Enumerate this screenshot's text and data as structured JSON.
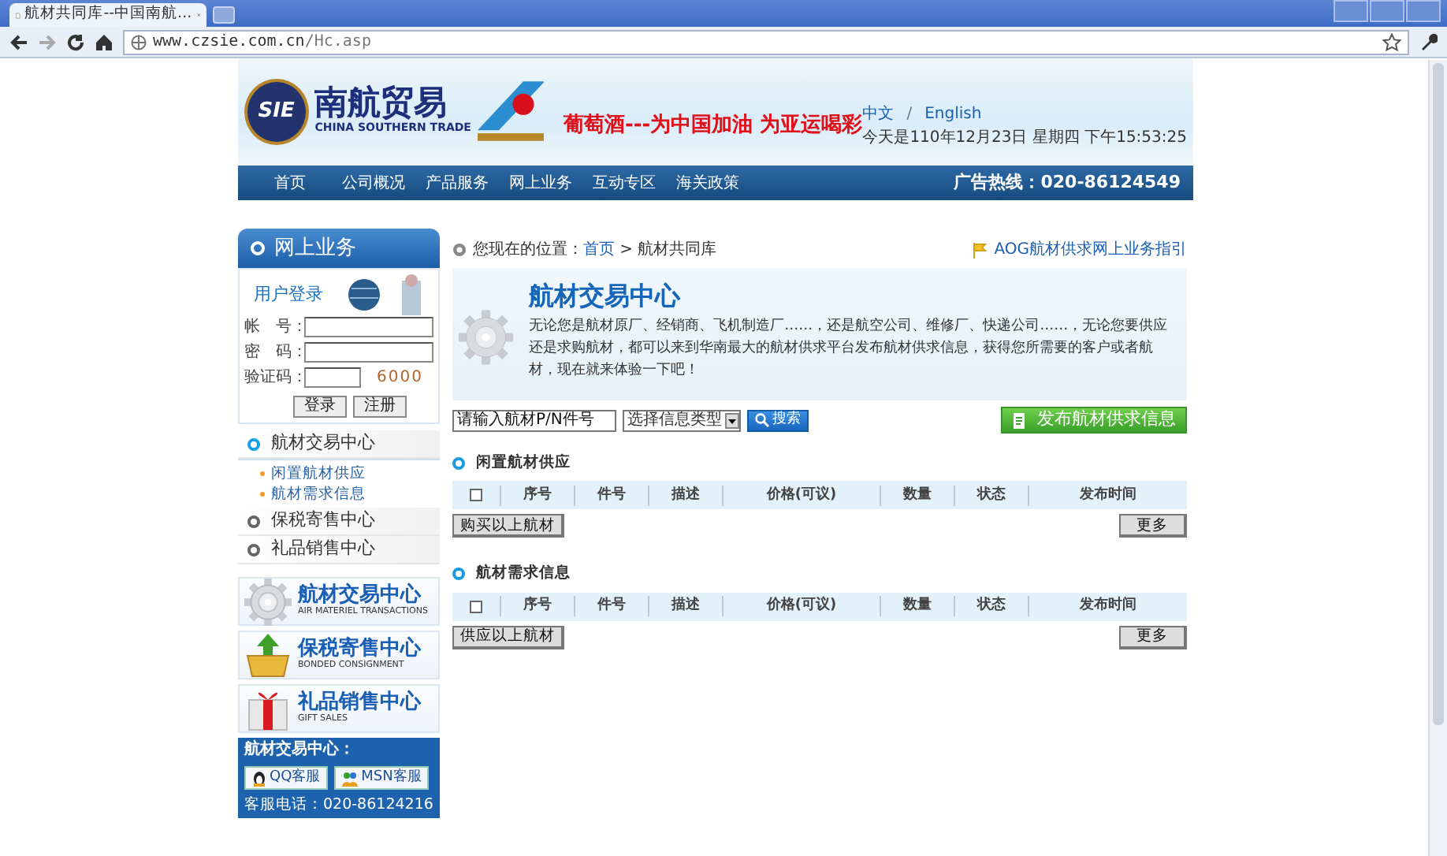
{
  "browser": {
    "tab_title": "航材共同库--中国南航...",
    "url_host": "www.czsie.com.cn",
    "url_path": "/Hc.asp"
  },
  "header": {
    "logo_mark": "SIE",
    "logo_cn": "南航贸易",
    "logo_en": "CHINA SOUTHERN TRADE",
    "slogan": "葡萄酒---为中国加油 为亚运喝彩",
    "languages": [
      "中文",
      "English"
    ],
    "language_separator": "/",
    "date": "今天是110年12月23日 星期四 下午15:53:25"
  },
  "nav": {
    "items": [
      "首页",
      "公司概况",
      "产品服务",
      "网上业务",
      "互动专区",
      "海关政策"
    ],
    "hotline": "广告热线：020-86124549"
  },
  "sidebar": {
    "title": "网上业务",
    "login": {
      "heading": "用户登录",
      "fields": [
        {
          "label": "帐　号："
        },
        {
          "label": "密　码："
        }
      ],
      "captcha_label": "验证码：",
      "captcha_code": "6000",
      "buttons": [
        "登录",
        "注册"
      ]
    },
    "menu": [
      {
        "label": "航材交易中心",
        "expanded": true,
        "children": [
          "闲置航材供应",
          "航材需求信息"
        ]
      },
      {
        "label": "保税寄售中心",
        "expanded": false
      },
      {
        "label": "礼品销售中心",
        "expanded": false
      }
    ],
    "banners": [
      {
        "kind": "gear",
        "title": "航材交易中心",
        "subtitle": "AIR MATERIEL TRANSACTIONS"
      },
      {
        "kind": "basket",
        "title": "保税寄售中心",
        "subtitle": "BONDED CONSIGNMENT"
      },
      {
        "kind": "gift",
        "title": "礼品销售中心",
        "subtitle": "GIFT SALES"
      }
    ],
    "contact": {
      "title": "航材交易中心：",
      "buttons": [
        {
          "kind": "qq",
          "label": "QQ客服"
        },
        {
          "kind": "msn",
          "label": "MSN客服"
        }
      ],
      "phone": "客服电话：020-86124216"
    }
  },
  "main": {
    "breadcrumb": {
      "prefix": "您现在的位置：",
      "home": "首页",
      "separator": ">",
      "current": "航材共同库"
    },
    "guide_link": "AOG航材供求网上业务指引",
    "intro": {
      "title": "航材交易中心",
      "text": "无论您是航材原厂、经销商、飞机制造厂……，还是航空公司、维修厂、快递公司……，无论您要供应还是求购航材，都可以来到华南最大的航材供求平台发布航材供求信息，获得您所需要的客户或者航材，现在就来体验一下吧！"
    },
    "search": {
      "value": "请输入航材P/N件号",
      "type_select": "选择信息类型",
      "button": "搜索"
    },
    "publish_button": "发布航材供求信息",
    "sections": [
      {
        "title": "闲置航材供应",
        "select_all_checked": false,
        "columns": [
          "序号",
          "件号",
          "描述",
          "价格(可议)",
          "数量",
          "状态",
          "发布时间"
        ],
        "action_button": "购买以上航材",
        "more_button": "更多"
      },
      {
        "title": "航材需求信息",
        "select_all_checked": false,
        "columns": [
          "序号",
          "件号",
          "描述",
          "价格(可议)",
          "数量",
          "状态",
          "发布时间"
        ],
        "action_button": "供应以上航材",
        "more_button": "更多"
      }
    ]
  }
}
